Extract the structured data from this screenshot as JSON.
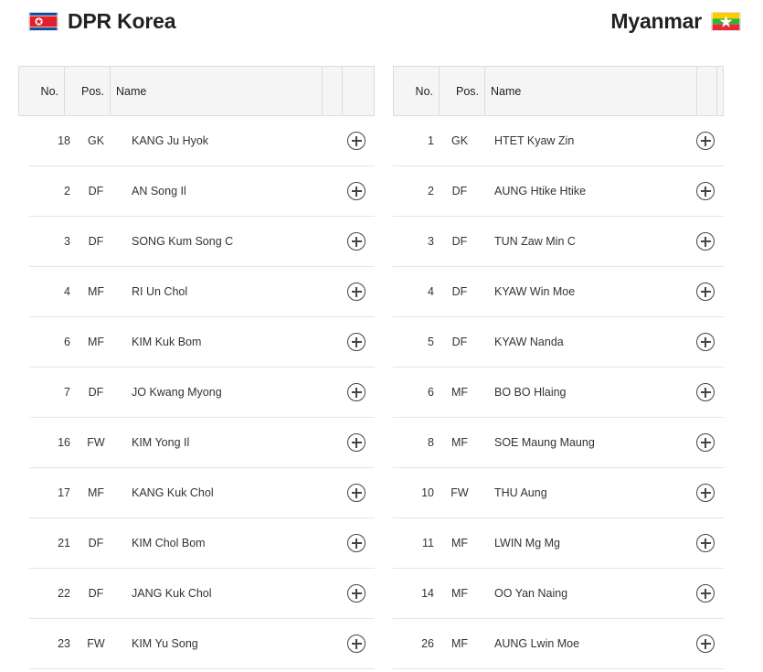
{
  "teams": [
    {
      "name": "DPR Korea",
      "flag_icon": "north-korea-flag-icon",
      "columns": {
        "no": "No.",
        "pos": "Pos.",
        "name": "Name"
      },
      "players": [
        {
          "no": "18",
          "pos": "GK",
          "name": "KANG Ju Hyok"
        },
        {
          "no": "2",
          "pos": "DF",
          "name": "AN Song Il"
        },
        {
          "no": "3",
          "pos": "DF",
          "name": "SONG Kum Song C"
        },
        {
          "no": "4",
          "pos": "MF",
          "name": "RI Un Chol"
        },
        {
          "no": "6",
          "pos": "MF",
          "name": "KIM Kuk Bom"
        },
        {
          "no": "7",
          "pos": "DF",
          "name": "JO Kwang Myong"
        },
        {
          "no": "16",
          "pos": "FW",
          "name": "KIM Yong Il"
        },
        {
          "no": "17",
          "pos": "MF",
          "name": "KANG Kuk Chol"
        },
        {
          "no": "21",
          "pos": "DF",
          "name": "KIM Chol Bom"
        },
        {
          "no": "22",
          "pos": "DF",
          "name": "JANG Kuk Chol"
        },
        {
          "no": "23",
          "pos": "FW",
          "name": "KIM Yu Song"
        }
      ]
    },
    {
      "name": "Myanmar",
      "flag_icon": "myanmar-flag-icon",
      "columns": {
        "no": "No.",
        "pos": "Pos.",
        "name": "Name"
      },
      "players": [
        {
          "no": "1",
          "pos": "GK",
          "name": "HTET Kyaw Zin"
        },
        {
          "no": "2",
          "pos": "DF",
          "name": "AUNG Htike Htike"
        },
        {
          "no": "3",
          "pos": "DF",
          "name": "TUN Zaw Min C"
        },
        {
          "no": "4",
          "pos": "DF",
          "name": "KYAW Win Moe"
        },
        {
          "no": "5",
          "pos": "DF",
          "name": "KYAW Nanda"
        },
        {
          "no": "6",
          "pos": "MF",
          "name": "BO BO Hlaing"
        },
        {
          "no": "8",
          "pos": "MF",
          "name": "SOE Maung Maung"
        },
        {
          "no": "10",
          "pos": "FW",
          "name": "THU Aung"
        },
        {
          "no": "11",
          "pos": "MF",
          "name": "LWIN Mg Mg"
        },
        {
          "no": "14",
          "pos": "MF",
          "name": "OO Yan Naing"
        },
        {
          "no": "26",
          "pos": "MF",
          "name": "AUNG Lwin Moe"
        }
      ]
    }
  ],
  "colors": {
    "header_bg": "#f5f5f5",
    "border": "#dcdcdc",
    "row_divider": "#e6e6e6",
    "text": "#333333",
    "title": "#222222"
  }
}
